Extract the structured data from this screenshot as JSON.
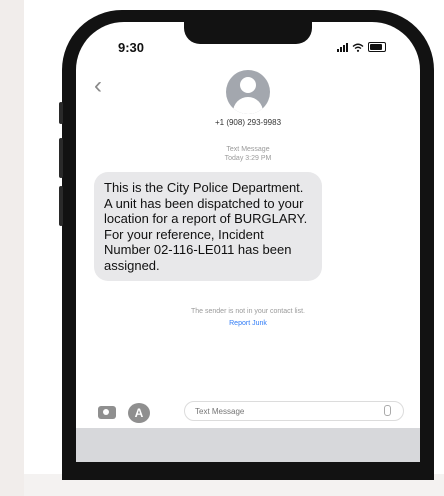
{
  "status_bar": {
    "time": "9:30"
  },
  "contact": {
    "phone": "+1 (908) 293-9983"
  },
  "thread_meta": {
    "type": "Text Message",
    "timestamp": "Today 3:29 PM"
  },
  "message": {
    "text": "This is the City Police Department. A unit has been dispatched to your location for a report of BURGLARY. For your reference, Incident Number 02-116-LE011 has been assigned."
  },
  "notice": {
    "text": "The sender is not in your contact list.",
    "report_link": "Report Junk"
  },
  "composer": {
    "placeholder": "Text Message"
  },
  "icons": {
    "back": "chevron-left-icon",
    "avatar": "person-icon",
    "camera": "camera-icon",
    "apps": "app-store-icon",
    "mic": "microphone-icon"
  },
  "colors": {
    "bubble": "#e8e8ea",
    "link": "#2f7bf6",
    "phone_frame": "#121212"
  }
}
